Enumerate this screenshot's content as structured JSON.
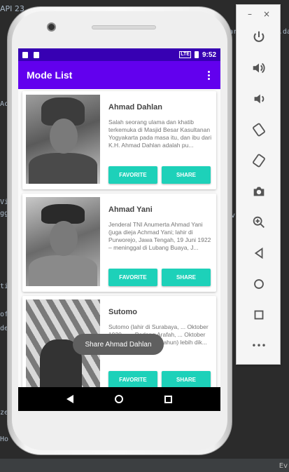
{
  "ide": {
    "tab_text": "API 23",
    "fragments": [
      "Ac",
      "Vi",
      "gg",
      "tic",
      "of",
      "de",
      "ze",
      "Ho",
      "ar",
      ".da",
      "v"
    ],
    "bottom_text": "Ev"
  },
  "status_bar": {
    "network": "LTE",
    "time": "9:52"
  },
  "app_bar": {
    "title": "Mode List"
  },
  "items": [
    {
      "name": "Ahmad Dahlan",
      "description": "Salah seorang ulama dan khatib terkemuka di Masjid Besar Kasultanan Yogyakarta pada masa itu, dan ibu dari K.H. Ahmad Dahlan adalah pu...",
      "favorite_label": "FAVORITE",
      "share_label": "SHARE"
    },
    {
      "name": "Ahmad Yani",
      "description": "Jenderal TNI Anumerta Ahmad Yani (juga dieja Achmad Yani; lahir di Purworejo, Jawa Tengah, 19 Juni 1922 – meninggal di Lubang Buaya, J...",
      "favorite_label": "FAVORITE",
      "share_label": "SHARE"
    },
    {
      "name": "Sutomo",
      "description": "Sutomo (lahir di Surabaya, ... Oktober 1920 – ... Padang Arafah, ... Oktober 1981 pada umur 61 tahun) lebih dik...",
      "favorite_label": "FAVORITE",
      "share_label": "SHARE"
    }
  ],
  "toast": {
    "text": "Share Ahmad Dahlan"
  },
  "toolbar": {
    "minimize": "–",
    "close": "×",
    "buttons": [
      "power-icon",
      "volume-up-icon",
      "volume-down-icon",
      "rotate-left-icon",
      "rotate-right-icon",
      "camera-icon",
      "zoom-icon",
      "back-icon",
      "home-icon",
      "overview-icon",
      "more-icon"
    ],
    "more_label": "•••"
  },
  "colors": {
    "primary": "#6200ee",
    "primary_dark": "#3700b3",
    "accent": "#1dd1b9"
  }
}
